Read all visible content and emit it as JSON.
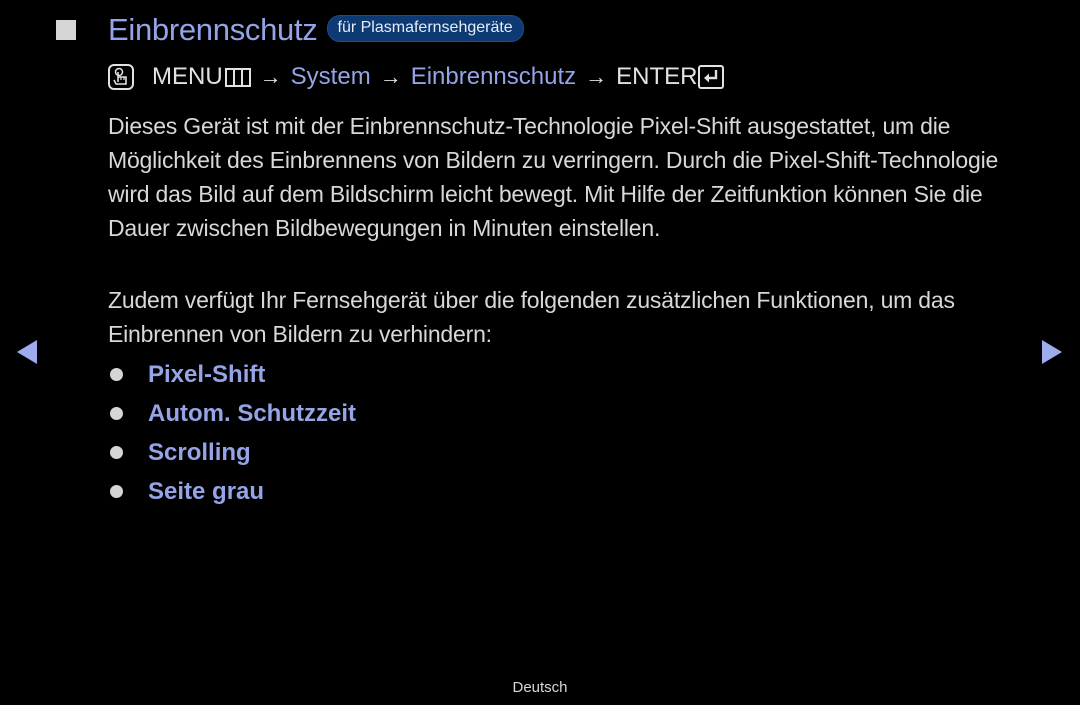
{
  "header": {
    "title": "Einbrennschutz",
    "badge": "für Plasmafernsehgeräte",
    "title_color": "#94a4e6",
    "badge_color": "#0e3a74"
  },
  "menu_path": {
    "icon": "hand-remote-icon",
    "menu_label": "MENU",
    "menu_icon": "menu-grid-icon",
    "arrow": "→",
    "system_label": "System",
    "item_label": "Einbrennschutz",
    "enter_label": "ENTER",
    "enter_icon": "enter-icon"
  },
  "content": {
    "paragraph1": "Dieses Gerät ist mit der Einbrennschutz-Technologie Pixel-Shift ausgestattet, um die Möglichkeit des Einbrennens von Bildern zu verringern. Durch die Pixel-Shift-Technologie wird das Bild auf dem Bildschirm leicht bewegt. Mit Hilfe der Zeitfunktion können Sie die Dauer zwischen Bildbewegungen in Minuten einstellen.",
    "paragraph2": "Zudem verfügt Ihr Fernsehgerät über die folgenden zusätzlichen Funktionen, um das Einbrennen von Bildern zu verhindern:",
    "features": [
      "Pixel-Shift",
      "Autom. Schutzzeit",
      "Scrolling",
      "Seite grau"
    ]
  },
  "navigation": {
    "prev_icon": "triangle-left-icon",
    "next_icon": "triangle-right-icon",
    "arrow_color": "#9cacec"
  },
  "footer": {
    "language": "Deutsch"
  }
}
